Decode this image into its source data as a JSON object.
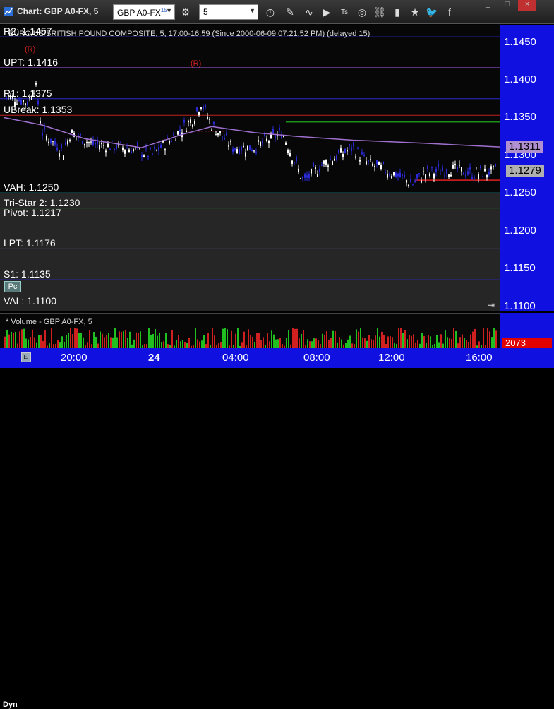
{
  "window": {
    "title": "Chart: GBP A0-FX, 5",
    "controls": [
      "_",
      "□",
      "×"
    ]
  },
  "toolbar": {
    "symbol": "GBP A0-FX",
    "symbol_sup": "15",
    "interval": "5",
    "icons": [
      "gear-icon",
      "clock-icon",
      "pencil-icon",
      "wave-icon",
      "play-icon",
      "ts-icon",
      "link-icon",
      "bars-icon",
      "star-icon",
      "twitter-icon",
      "facebook-icon"
    ]
  },
  "info": {
    "line": "EURO/US/BRITISH POUND COMPOSITE, 5, 17:00-16:59 (Since 2000-06-09 07:21:52 PM) (delayed 15)"
  },
  "markers": {
    "r1": "(R)",
    "r2": "(R)"
  },
  "levels": [
    {
      "name": "R2",
      "label": "R2: 1.1457",
      "price": 1.1457,
      "color": "#2a2ad0"
    },
    {
      "name": "UPT",
      "label": "UPT: 1.1416",
      "price": 1.1416,
      "color": "#8a4fc0"
    },
    {
      "name": "R1",
      "label": "R1: 1.1375",
      "price": 1.1375,
      "color": "#2a2ad0"
    },
    {
      "name": "UBreak",
      "label": "UBreak: 1.1353",
      "price": 1.1353,
      "color": "#c02020"
    },
    {
      "name": "VAH",
      "label": "VAH: 1.1250",
      "price": 1.125,
      "color": "#20c0d0"
    },
    {
      "name": "Tri-Star 2",
      "label": "Tri-Star 2: 1.1230",
      "price": 1.123,
      "color": "#20a020"
    },
    {
      "name": "Pivot",
      "label": "Pivot: 1.1217",
      "price": 1.1217,
      "color": "#2a2ad0"
    },
    {
      "name": "LPT",
      "label": "LPT: 1.1176",
      "price": 1.1176,
      "color": "#8a4fc0"
    },
    {
      "name": "S1",
      "label": "S1: 1.1135",
      "price": 1.1135,
      "color": "#2a2ad0"
    },
    {
      "name": "VAL",
      "label": "VAL: 1.1100",
      "price": 1.11,
      "color": "#20c0d0"
    }
  ],
  "price_axis": {
    "ticks": [
      "1.1450",
      "1.1400",
      "1.1350",
      "1.1300",
      "1.1250",
      "1.1200",
      "1.1150",
      "1.1100"
    ],
    "min": 1.1093,
    "max": 1.1473
  },
  "badges": {
    "vwap": {
      "label": "1.1311",
      "color": "#b090d0"
    },
    "last": {
      "label": "1.1279",
      "color": "#b0b0b0"
    }
  },
  "time_axis": {
    "ticks": [
      "20:00",
      "24",
      "04:00",
      "08:00",
      "12:00",
      "16:00"
    ]
  },
  "volume": {
    "title": "* Volume - GBP A0-FX, 5",
    "last": "2073"
  },
  "status": {
    "dyn": "Dyn",
    "pc": "Pc"
  },
  "colors": {
    "axis_bg": "#1010e0",
    "up": "#ffffff",
    "down": "#2a2ad8",
    "vwap": "#a070d0",
    "vol_up": "#20c020",
    "vol_down": "#d02020"
  }
}
